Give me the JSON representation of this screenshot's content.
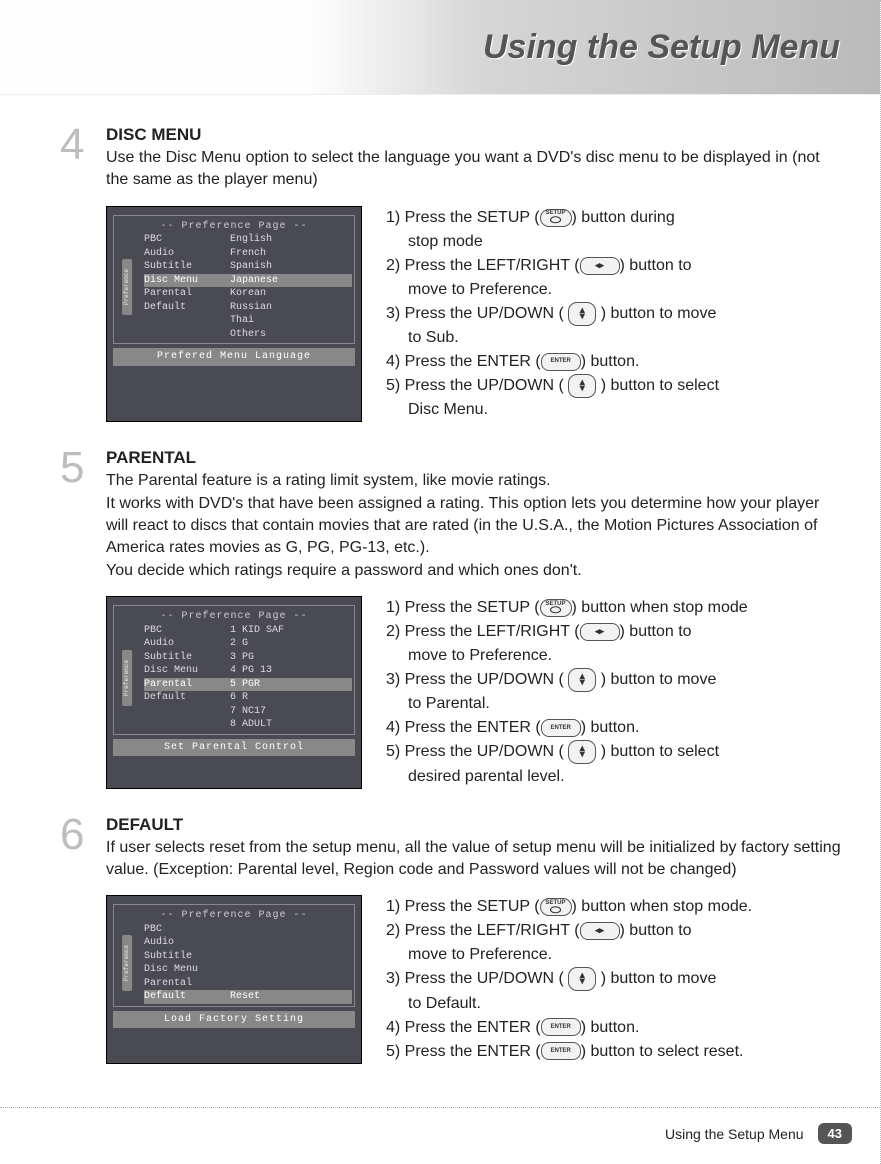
{
  "header": {
    "title": "Using the Setup Menu"
  },
  "sections": [
    {
      "num": "4",
      "title": "DISC MENU",
      "desc": "Use the Disc Menu option to select the language you want a DVD's disc menu to be displayed in (not the same as the player menu)",
      "screenshot": {
        "header": "-- Preference Page --",
        "side": "Preference",
        "items": [
          {
            "label": "PBC",
            "val": "English"
          },
          {
            "label": "Audio",
            "val": "French"
          },
          {
            "label": "Subtitle",
            "val": "Spanish"
          },
          {
            "label": "Disc Menu",
            "val": "Japanese",
            "hi": true
          },
          {
            "label": "Parental",
            "val": "Korean"
          },
          {
            "label": "Default",
            "val": "Russian"
          },
          {
            "label": "",
            "val": "Thai"
          },
          {
            "label": "",
            "val": "Others"
          }
        ],
        "footer": "Prefered Menu Language"
      },
      "steps": {
        "s1": "1) Press the SETUP (",
        "s1b": ") button during",
        "s1c": "stop mode",
        "s2": "2) Press the LEFT/RIGHT (",
        "s2b": ") button to",
        "s2c": "move to Preference.",
        "s3": "3) Press the UP/DOWN (",
        "s3b": ") button to move",
        "s3c": "to Sub.",
        "s4": "4) Press the ENTER (",
        "s4b": ") button.",
        "s5": "5) Press the UP/DOWN (",
        "s5b": ") button to select",
        "s5c": "Disc Menu."
      }
    },
    {
      "num": "5",
      "title": "PARENTAL",
      "desc": "The Parental feature is a rating limit system, like movie ratings.\nIt works with DVD's that have been assigned a rating. This option lets you determine how your player will react to discs that contain movies that are rated (in the U.S.A., the Motion Pictures Association of America rates movies as G, PG, PG-13, etc.).\nYou decide which ratings require a password and which ones don't.",
      "screenshot": {
        "header": "-- Preference Page --",
        "side": "Preference",
        "items": [
          {
            "label": "PBC",
            "val": "1 KID SAF"
          },
          {
            "label": "Audio",
            "val": "2 G"
          },
          {
            "label": "Subtitle",
            "val": "3 PG"
          },
          {
            "label": "Disc Menu",
            "val": "4 PG 13"
          },
          {
            "label": "Parental",
            "val": "5 PGR",
            "hi": true
          },
          {
            "label": "Default",
            "val": "6 R"
          },
          {
            "label": "",
            "val": "7 NC17"
          },
          {
            "label": "",
            "val": "8 ADULT"
          }
        ],
        "footer": "Set Parental Control"
      },
      "steps": {
        "s1": "1) Press the SETUP (",
        "s1b": ") button when stop mode",
        "s1c": "",
        "s2": "2) Press the LEFT/RIGHT (",
        "s2b": ") button to",
        "s2c": "move to Preference.",
        "s3": "3) Press the UP/DOWN (",
        "s3b": ") button to move",
        "s3c": "to Parental.",
        "s4": "4) Press the ENTER (",
        "s4b": ") button.",
        "s5": "5) Press the UP/DOWN (",
        "s5b": ") button to select",
        "s5c": "desired parental level."
      }
    },
    {
      "num": "6",
      "title": "DEFAULT",
      "desc": "If user selects reset from the setup menu, all the value of setup menu will be initialized by factory setting value. (Exception:   Parental level, Region code and Password values will not be changed)",
      "screenshot": {
        "header": "-- Preference Page --",
        "side": "Preference",
        "items": [
          {
            "label": "PBC",
            "val": ""
          },
          {
            "label": "Audio",
            "val": ""
          },
          {
            "label": "Subtitle",
            "val": ""
          },
          {
            "label": "Disc Menu",
            "val": ""
          },
          {
            "label": "Parental",
            "val": ""
          },
          {
            "label": "Default",
            "val": "Reset",
            "hi": true
          }
        ],
        "footer": "Load Factory Setting"
      },
      "steps": {
        "s1": "1) Press the SETUP (",
        "s1b": ") button when stop mode.",
        "s1c": "",
        "s2": "2) Press the LEFT/RIGHT (",
        "s2b": ") button to",
        "s2c": "move to Preference.",
        "s3": "3) Press the UP/DOWN (",
        "s3b": ") button to move",
        "s3c": "to Default.",
        "s4": "4) Press the ENTER (",
        "s4b": ") button.",
        "s5a": "5) Press the ENTER (",
        "s5ab": ") button to select reset."
      }
    }
  ],
  "footer": {
    "text": "Using the Setup Menu",
    "page": "43"
  }
}
